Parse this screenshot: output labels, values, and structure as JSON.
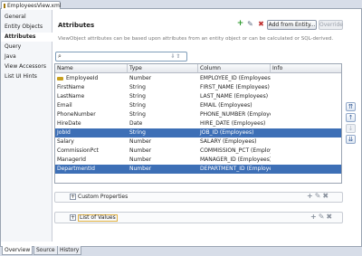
{
  "editor_tab": {
    "label": "EmployeesView.xml"
  },
  "sidebar": {
    "items": [
      {
        "label": "General"
      },
      {
        "label": "Entity Objects"
      },
      {
        "label": "Attributes"
      },
      {
        "label": "Query"
      },
      {
        "label": "Java"
      },
      {
        "label": "View Accessors"
      },
      {
        "label": "List UI Hints"
      }
    ]
  },
  "section": {
    "title": "Attributes",
    "add_button": "Add from Entity...",
    "override_button": "Override",
    "description": "ViewObject attributes can be based upon attributes from an entity object or can be calculated or SQL-derived."
  },
  "table": {
    "columns": [
      "Name",
      "Type",
      "Column",
      "Info"
    ],
    "rows": [
      {
        "name": "EmployeeId",
        "type": "Number",
        "column": "EMPLOYEE_ID (Employees)",
        "key": true
      },
      {
        "name": "FirstName",
        "type": "String",
        "column": "FIRST_NAME (Employees)"
      },
      {
        "name": "LastName",
        "type": "String",
        "column": "LAST_NAME (Employees)"
      },
      {
        "name": "Email",
        "type": "String",
        "column": "EMAIL (Employees)"
      },
      {
        "name": "PhoneNumber",
        "type": "String",
        "column": "PHONE_NUMBER (Employees)"
      },
      {
        "name": "HireDate",
        "type": "Date",
        "column": "HIRE_DATE (Employees)"
      },
      {
        "name": "JobId",
        "type": "String",
        "column": "JOB_ID (Employees)",
        "selected": true
      },
      {
        "name": "Salary",
        "type": "Number",
        "column": "SALARY (Employees)"
      },
      {
        "name": "CommissionPct",
        "type": "Number",
        "column": "COMMISSION_PCT (Employees)"
      },
      {
        "name": "ManagerId",
        "type": "Number",
        "column": "MANAGER_ID (Employees)"
      },
      {
        "name": "DepartmentId",
        "type": "Number",
        "column": "DEPARTMENT_ID (Employees)",
        "selected": true
      }
    ]
  },
  "panels": {
    "custom_properties": "Custom Properties",
    "list_of_values": "List of Values"
  },
  "bottom_tabs": [
    "Overview",
    "Source",
    "History"
  ],
  "colors": {
    "selection": "#3d6fb6",
    "add": "#2e9a2e",
    "delete": "#c03030",
    "key": "#c8a020"
  }
}
